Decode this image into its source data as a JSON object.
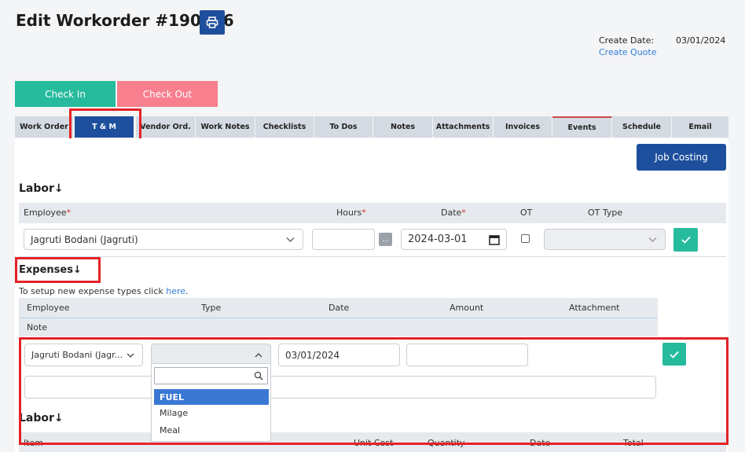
{
  "header": {
    "title": "Edit Workorder #190106",
    "create_date_label": "Create Date:",
    "create_date_value": "03/01/2024",
    "create_quote_link": "Create Quote"
  },
  "actions": {
    "check_in": "Check In",
    "check_out": "Check Out",
    "job_costing": "Job Costing"
  },
  "tabs": [
    {
      "label": "Work Order"
    },
    {
      "label": "T & M"
    },
    {
      "label": "Vendor Ord."
    },
    {
      "label": "Work Notes"
    },
    {
      "label": "Checklists"
    },
    {
      "label": "To Dos"
    },
    {
      "label": "Notes"
    },
    {
      "label": "Attachments"
    },
    {
      "label": "Invoices"
    },
    {
      "label": "Events"
    },
    {
      "label": "Schedule"
    },
    {
      "label": "Email"
    }
  ],
  "labor": {
    "heading": "Labor",
    "arrow": "↓",
    "col_employee": "Employee",
    "col_hours": "Hours",
    "col_date": "Date",
    "col_ot": "OT",
    "col_ot_type": "OT Type",
    "required_mark": "*",
    "employee_value": "Jagruti Bodani (Jagruti)",
    "hours_value": "",
    "hours_more": "...",
    "date_value": "2024-03-01",
    "ot_type_value": ""
  },
  "expenses": {
    "heading": "Expenses",
    "arrow": "↓",
    "setup_text": "To setup new expense types click ",
    "setup_link": "here",
    "setup_end": ".",
    "col_employee": "Employee",
    "col_type": "Type",
    "col_date": "Date",
    "col_amount": "Amount",
    "col_attachment": "Attachment",
    "col_note": "Note",
    "employee_value": "Jagruti Bodani (Jagr...",
    "type_value": "",
    "date_value": "03/01/2024",
    "amount_value": "",
    "note_value": "",
    "type_options": [
      "FUEL",
      "Milage",
      "Meal"
    ],
    "type_selected": "FUEL"
  },
  "labor2": {
    "heading": "Labor",
    "arrow": "↓",
    "col_item": "Item",
    "col_unit_cost": "Unit Cost",
    "col_quantity": "Quantity",
    "col_date": "Date",
    "col_total": "Total"
  },
  "colors": {
    "primary": "#1d4f9c",
    "check_in": "#26bb9c",
    "check_out": "#f77f8e",
    "highlight": "#e32228",
    "link": "#2f7fd6"
  }
}
